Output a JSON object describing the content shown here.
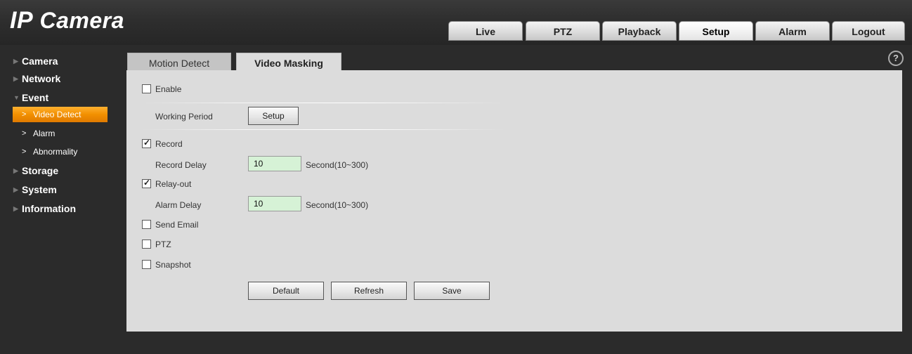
{
  "app": {
    "logo_ip": "IP",
    "logo_text": "Camera"
  },
  "nav": {
    "tabs": [
      {
        "label": "Live"
      },
      {
        "label": "PTZ"
      },
      {
        "label": "Playback"
      },
      {
        "label": "Setup",
        "active": true
      },
      {
        "label": "Alarm"
      },
      {
        "label": "Logout"
      }
    ]
  },
  "sidebar": {
    "items": [
      {
        "label": "Camera"
      },
      {
        "label": "Network"
      },
      {
        "label": "Event"
      },
      {
        "label": "Storage"
      },
      {
        "label": "System"
      },
      {
        "label": "Information"
      }
    ],
    "event_sub": [
      {
        "label": "Video Detect",
        "active": true
      },
      {
        "label": "Alarm"
      },
      {
        "label": "Abnormality"
      }
    ]
  },
  "content": {
    "tabs": [
      {
        "label": "Motion Detect"
      },
      {
        "label": "Video Masking",
        "active": true
      }
    ],
    "help_icon": "?",
    "enable": {
      "label": "Enable",
      "checked": false
    },
    "working_period": {
      "label": "Working Period",
      "button": "Setup"
    },
    "record": {
      "label": "Record",
      "checked": true
    },
    "record_delay": {
      "label": "Record Delay",
      "value": "10",
      "unit": "Second(10~300)"
    },
    "relay_out": {
      "label": "Relay-out",
      "checked": true
    },
    "alarm_delay": {
      "label": "Alarm Delay",
      "value": "10",
      "unit": "Second(10~300)"
    },
    "send_email": {
      "label": "Send Email",
      "checked": false
    },
    "ptz": {
      "label": "PTZ",
      "checked": false
    },
    "snapshot": {
      "label": "Snapshot",
      "checked": false
    },
    "buttons": {
      "default": "Default",
      "refresh": "Refresh",
      "save": "Save"
    }
  },
  "colors": {
    "accent": "#f29000",
    "input_bg": "#d6f2d6",
    "panel_bg": "#dcdcdc",
    "page_bg": "#2b2b2b"
  },
  "icons": {
    "help": "help-icon",
    "chevron": "chevron-right-icon",
    "triangle": "triangle-right-icon"
  }
}
